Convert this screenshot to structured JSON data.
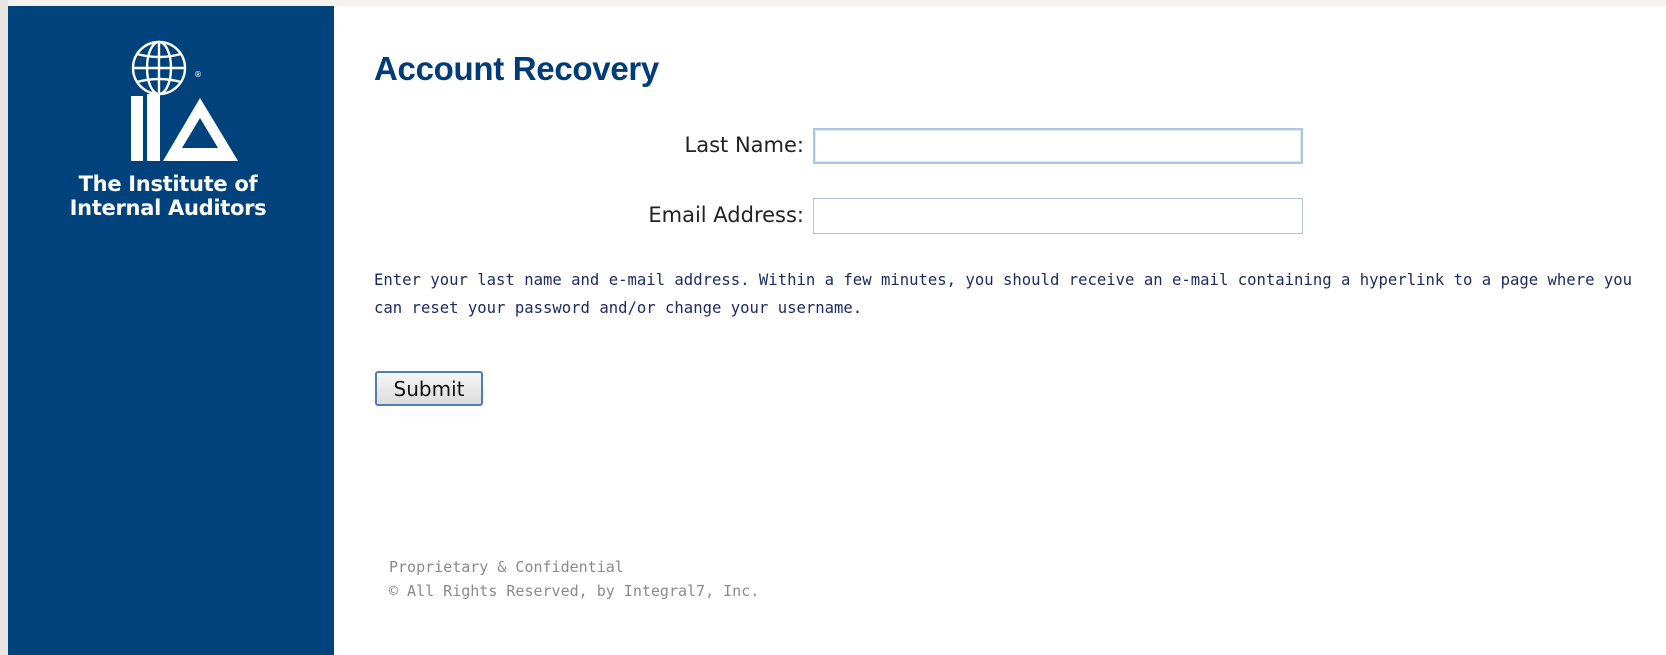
{
  "brand": {
    "logo_letters": "IIA",
    "name_line1": "The Institute of",
    "name_line2": "Internal Auditors",
    "registered_mark": "®",
    "color_primary": "#00427b"
  },
  "page": {
    "title": "Account Recovery"
  },
  "form": {
    "last_name": {
      "label": "Last Name:",
      "value": ""
    },
    "email": {
      "label": "Email Address:",
      "value": ""
    },
    "help_text": "Enter your last name and e-mail address. Within a few minutes, you should receive an e-mail containing a hyperlink to a page where you can reset your password and/or change your username.",
    "submit_label": "Submit"
  },
  "footer": {
    "line1": "Proprietary & Confidential",
    "line2": "© All Rights Reserved, by Integral7, Inc."
  }
}
